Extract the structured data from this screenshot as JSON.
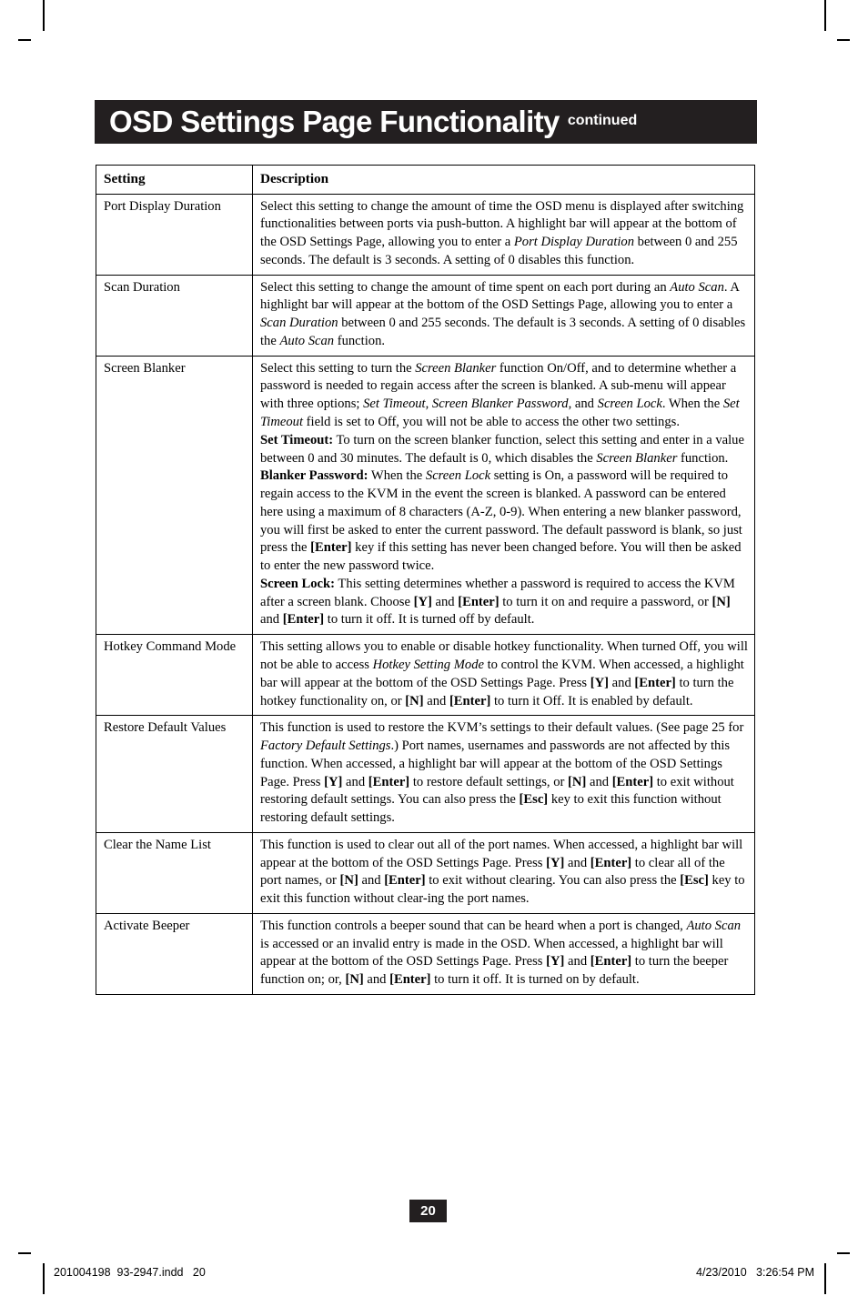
{
  "header": {
    "title": "OSD Settings Page Functionality",
    "continued_label": "continued",
    "bar_color": "#231f20"
  },
  "table": {
    "columns": {
      "setting": "Setting",
      "description": "Description"
    },
    "rows": [
      {
        "setting": "Port Display Duration",
        "description_html": "Select this setting to change the amount of time the OSD menu is displayed after switching functionalities between ports via push-button. A highlight bar will appear at the bottom of the OSD Settings Page, allowing you to enter a <em>Port Display Duration</em> between 0 and 255 seconds. The default is 3 seconds. A setting of 0 disables this function."
      },
      {
        "setting": "Scan Duration",
        "description_html": "Select this setting to change the amount of time spent on each port during an <em>Auto Scan</em>. A highlight bar will appear at the bottom of the OSD Settings Page, allowing you to enter a <em>Scan Duration</em> between 0 and 255 seconds. The default is 3 seconds. A setting of 0 disables the <em>Auto Scan</em> function."
      },
      {
        "setting": "Screen Blanker",
        "description_html": "Select this setting to turn the <em>Screen Blanker</em> function On/Off, and to determine whether a password is needed to regain access after the screen is blanked. A sub-menu will appear with three options; <em>Set Timeout</em>, <em>Screen Blanker Password</em>, and <em>Screen Lock</em>. When the <em>Set Timeout</em> field is set to Off, you will not be able to access the other two settings.<br><b>Set Timeout:</b> To turn on the screen blanker function, select this setting and enter in a value between 0 and 30 minutes. The default is 0, which disables the <em>Screen Blanker</em> function.<br><b>Blanker Password:</b> When the <em>Screen Lock</em> setting is On, a password will be required to regain access to the KVM in the event the screen is blanked. A password can be entered here using a maximum of 8 characters (A-Z, 0-9). When entering a new blanker password, you will first be asked to enter the current password. The default password is blank, so just press the <b>[Enter]</b> key if this setting has never been changed before. You will then be asked to enter the new password twice.<br><b>Screen Lock:</b> This setting determines whether a password is required to access the KVM after a screen blank. Choose <b>[Y]</b> and <b>[Enter]</b> to turn it on and require a password, or <b>[N]</b> and <b>[Enter]</b> to turn it off. It is turned off by default."
      },
      {
        "setting": "Hotkey Command Mode",
        "description_html": "This setting allows you to enable or disable hotkey functionality. When turned Off, you will not be able to access <em>Hotkey Setting Mode</em> to control the KVM. When accessed, a highlight bar will appear at the bottom of the OSD Settings Page. Press <b>[Y]</b> and <b>[Enter]</b> to turn the hotkey functionality on, or <b>[N]</b> and <b>[Enter]</b> to turn it Off. It is enabled by default."
      },
      {
        "setting": "Restore Default Values",
        "description_html": "This function is used to restore the KVM’s settings to their default values. (See page 25 for <em>Factory Default Settings</em>.) Port names, usernames and passwords are not affected by this function. When accessed, a highlight bar will appear at the bottom of the OSD Settings Page. Press <b>[Y]</b> and <b>[Enter]</b> to restore default settings, or <b>[N]</b> and <b>[Enter]</b> to exit without restoring default settings. You can also press the <b>[Esc]</b> key to exit this function without restoring default settings."
      },
      {
        "setting": "Clear the Name List",
        "description_html": "This function is used to clear out all of the port names. When accessed, a highlight bar will appear at the bottom of the OSD Settings Page. Press <b>[Y]</b> and <b>[Enter]</b> to clear all of the port names, or <b>[N]</b> and <b>[Enter]</b> to exit without clearing. You can also press the <b>[Esc]</b> key to exit this function without clear-ing the port names."
      },
      {
        "setting": "Activate Beeper",
        "description_html": "This function controls a beeper sound that can be heard when a port is changed, <em>Auto Scan</em> is accessed or an invalid entry is made in the OSD. When accessed, a highlight bar will appear at the bottom of the OSD Settings Page. Press <b>[Y]</b> and <b>[Enter]</b> to turn the beeper function on; or, <b>[N]</b> and <b>[Enter]</b> to turn it off. It is turned on by default."
      }
    ]
  },
  "page_number": "20",
  "print_slug": {
    "left": "201004198  93-2947.indd   20",
    "right": "4/23/2010   3:26:54 PM"
  }
}
